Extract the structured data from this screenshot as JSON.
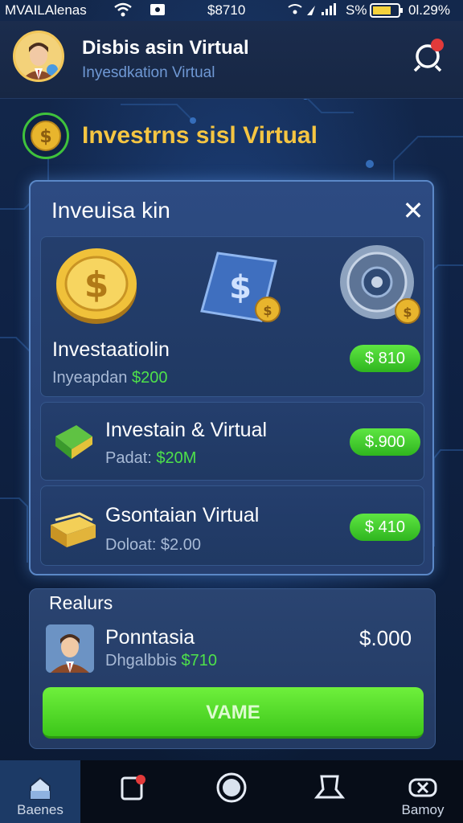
{
  "status_bar": {
    "carrier": "MVAILAlenas",
    "center": "$8710",
    "battery_pct": "S%",
    "time": "0l.29%"
  },
  "header": {
    "title": "Disbis asin Virtual",
    "subtitle": "Inyesdkation Virtual",
    "avatar_icon": "user-avatar",
    "notification_icon": "search-bell-icon"
  },
  "section": {
    "title": "Investrns sisl Virtual",
    "icon": "coin-icon"
  },
  "modal": {
    "title": "Inveuisa kin",
    "close_label": "✕",
    "cards": [
      {
        "title": "Investaatiolin",
        "sub_label": "Inyeapdan",
        "sub_amount": "$200",
        "price": "$ 810",
        "icons": [
          "gold-coin-icon",
          "blue-card-coin-icon",
          "safe-dial-icon"
        ]
      },
      {
        "title": "Investain & Virtual",
        "sub_label": "Padat:",
        "sub_amount": "$20M",
        "price": "$.900",
        "icon": "green-cash-icon"
      },
      {
        "title": "Gsontaian Virtual",
        "sub_label": "Doloat: $2.00",
        "sub_amount": "",
        "price": "$ 410",
        "icon": "gold-bars-icon"
      }
    ]
  },
  "realtors": {
    "title": "Realurs",
    "person": {
      "name": "Ponntasia",
      "sub_label": "Dhgalbbis",
      "sub_amount": "$710",
      "amount": "$.000"
    },
    "cta_label": "VAME"
  },
  "bottom_nav": [
    {
      "label": "Baenes",
      "icon": "home-icon",
      "active": true
    },
    {
      "label": "",
      "icon": "notification-icon",
      "active": false
    },
    {
      "label": "",
      "icon": "record-icon",
      "active": false
    },
    {
      "label": "",
      "icon": "profile-icon",
      "active": false
    },
    {
      "label": "Bamoy",
      "icon": "gamepad-icon",
      "active": false
    }
  ],
  "colors": {
    "accent_gold": "#f5c542",
    "accent_green": "#4ee14a",
    "panel_blue": "#2d4b82",
    "background": "#0b1a33"
  }
}
